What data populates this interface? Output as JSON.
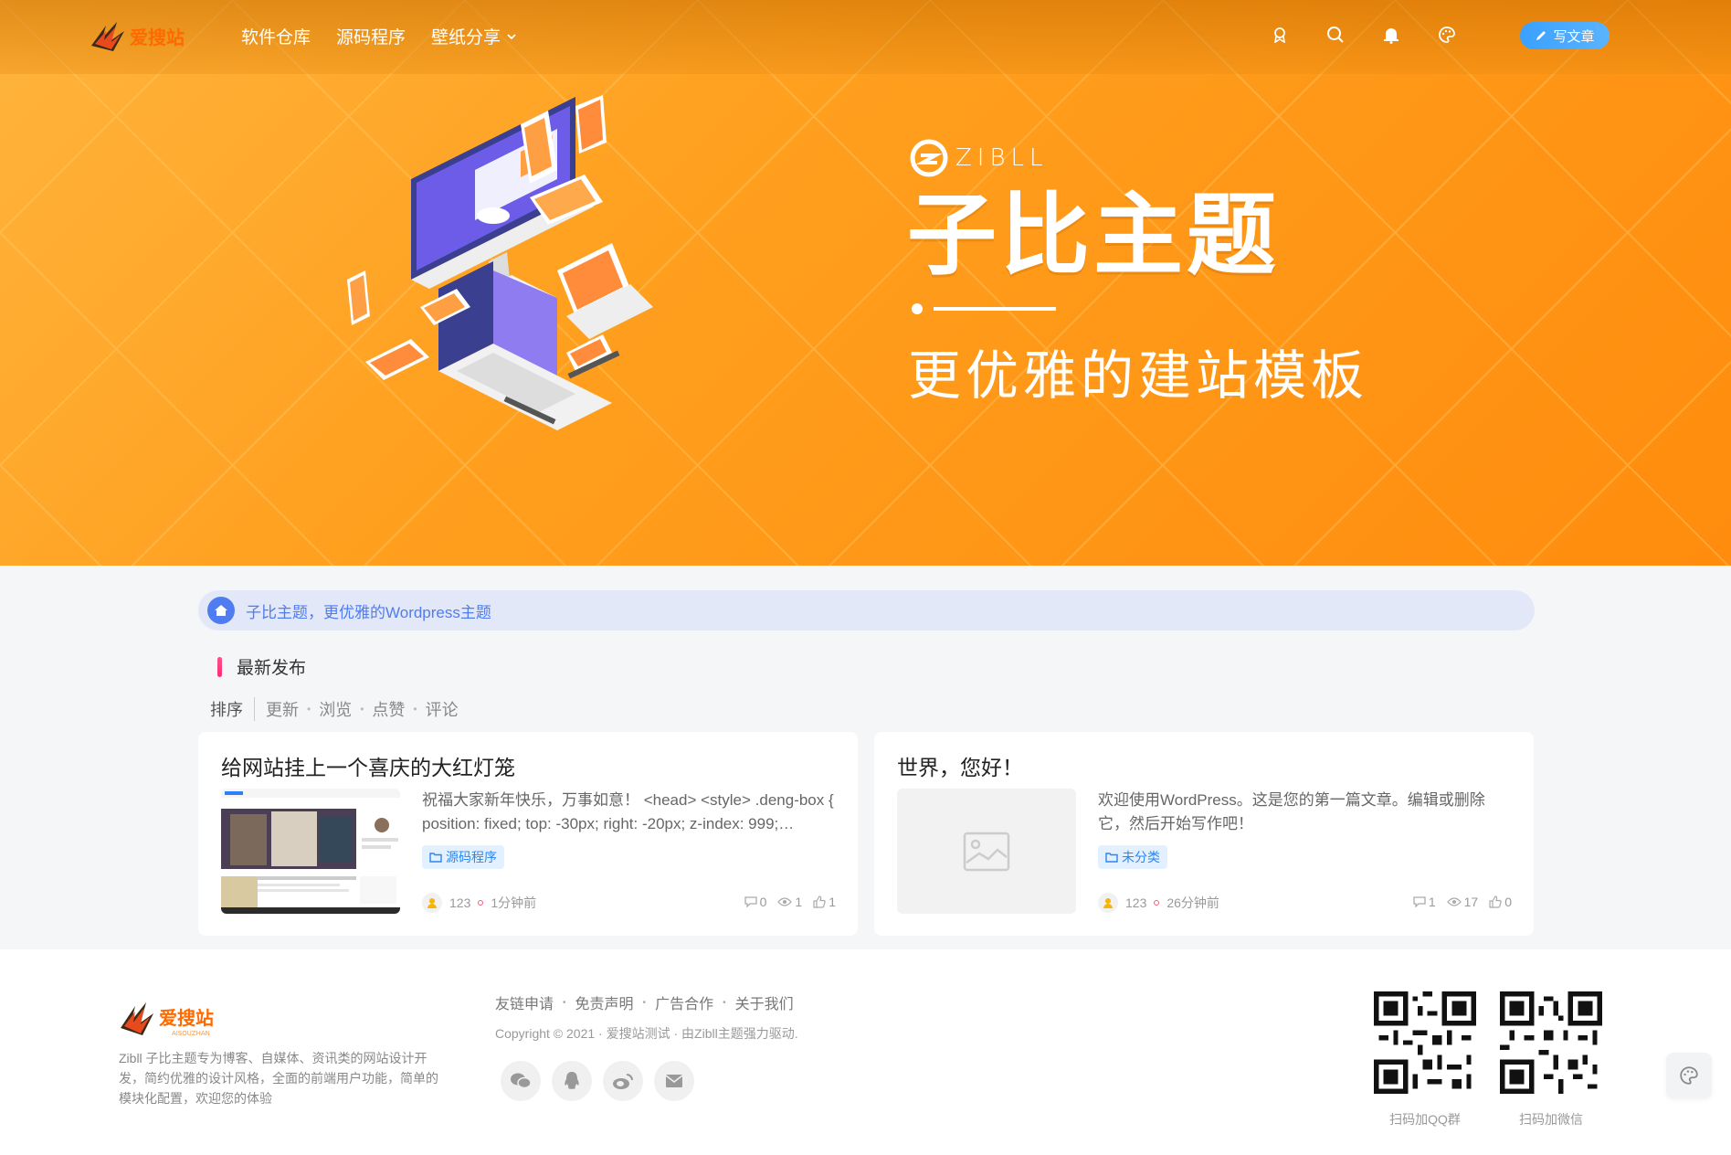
{
  "header": {
    "logo_text": "爱搜站",
    "nav": [
      {
        "label": "软件仓库"
      },
      {
        "label": "源码程序"
      },
      {
        "label": "壁纸分享"
      }
    ],
    "icons": [
      "medal-icon",
      "search-icon",
      "bell-icon",
      "palette-icon"
    ],
    "write_label": "写文章"
  },
  "hero": {
    "brand": "ZIBLL",
    "title": "子比主题",
    "subtitle": "更优雅的建站模板"
  },
  "notice": {
    "text": "子比主题，更优雅的Wordpress主题"
  },
  "section": {
    "title": "最新发布"
  },
  "sort": {
    "label": "排序",
    "items": [
      "更新",
      "浏览",
      "点赞",
      "评论"
    ]
  },
  "posts": [
    {
      "title": "给网站挂上一个喜庆的大红灯笼",
      "excerpt": "祝福大家新年快乐，万事如意！ <head> <style> .deng-box { position: fixed; top: -30px; right: -20px; z-index: 999;…",
      "category": "源码程序",
      "author": "123",
      "time": "1分钟前",
      "comments": "0",
      "views": "1",
      "likes": "1"
    },
    {
      "title": "世界，您好！",
      "excerpt": "欢迎使用WordPress。这是您的第一篇文章。编辑或删除它，然后开始写作吧！",
      "category": "未分类",
      "author": "123",
      "time": "26分钟前",
      "comments": "1",
      "views": "17",
      "likes": "0"
    }
  ],
  "footer": {
    "logo_text": "爱搜站",
    "logo_sub": "AISOUZHAN",
    "description": "Zibll 子比主题专为博客、自媒体、资讯类的网站设计开发，简约优雅的设计风格，全面的前端用户功能，简单的模块化配置，欢迎您的体验",
    "links": [
      "友链申请",
      "免责声明",
      "广告合作",
      "关于我们"
    ],
    "copyright": "Copyright © 2021 · 爱搜站测试 · 由Zibll主题强力驱动.",
    "social": [
      "wechat-icon",
      "qq-icon",
      "weibo-icon",
      "mail-icon"
    ],
    "qr": [
      {
        "label": "扫码加QQ群"
      },
      {
        "label": "扫码加微信"
      }
    ]
  },
  "colors": {
    "accent": "#ff9410",
    "link": "#4f7cf0",
    "tag": "#2a86f0"
  }
}
